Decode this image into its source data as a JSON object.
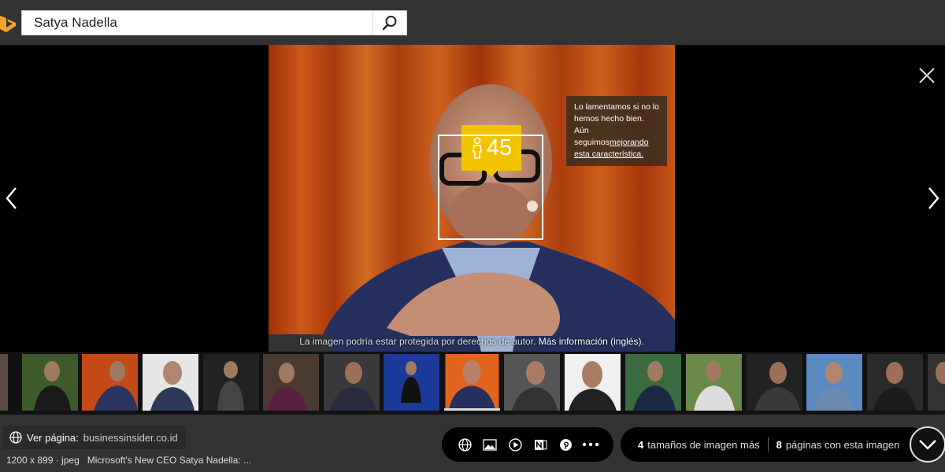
{
  "search": {
    "query": "Satya Nadella"
  },
  "viewer": {
    "age_value": "45",
    "tooltip_line1": "Lo lamentamos si no lo hemos hecho bien. Aún seguimos",
    "tooltip_link": "mejorando esta característica.",
    "copyright_text": "La imagen podría estar protegida por derechos de autor.",
    "copyright_link": "Más información (inglés).",
    "thumbnail_count": 16,
    "selected_thumbnail": 7
  },
  "footer": {
    "ver_pagina_label": "Ver página:",
    "domain": "businessinsider.co.id",
    "meta_dims": "1200 x 899 · jpeg",
    "meta_title": "Microsoft's New CEO Satya Nadella: ...",
    "more_sizes_count": "4",
    "more_sizes_label": "tamaños de imagen más",
    "pages_count": "8",
    "pages_label": "páginas con esta imagen"
  },
  "icons": {
    "logo": "bing-logo-icon",
    "search": "search-icon",
    "prev": "chevron-left-icon",
    "next": "chevron-right-icon",
    "close": "close-icon",
    "person": "person-icon",
    "globe": "globe-icon",
    "image": "image-icon",
    "video": "play-icon",
    "onenote": "onenote-icon",
    "pinterest": "pinterest-icon",
    "more": "more-icon",
    "expand": "chevron-down-icon"
  },
  "colors": {
    "accent": "#f2c400",
    "topbar": "#333333",
    "bing_orange": "#f5a623"
  }
}
